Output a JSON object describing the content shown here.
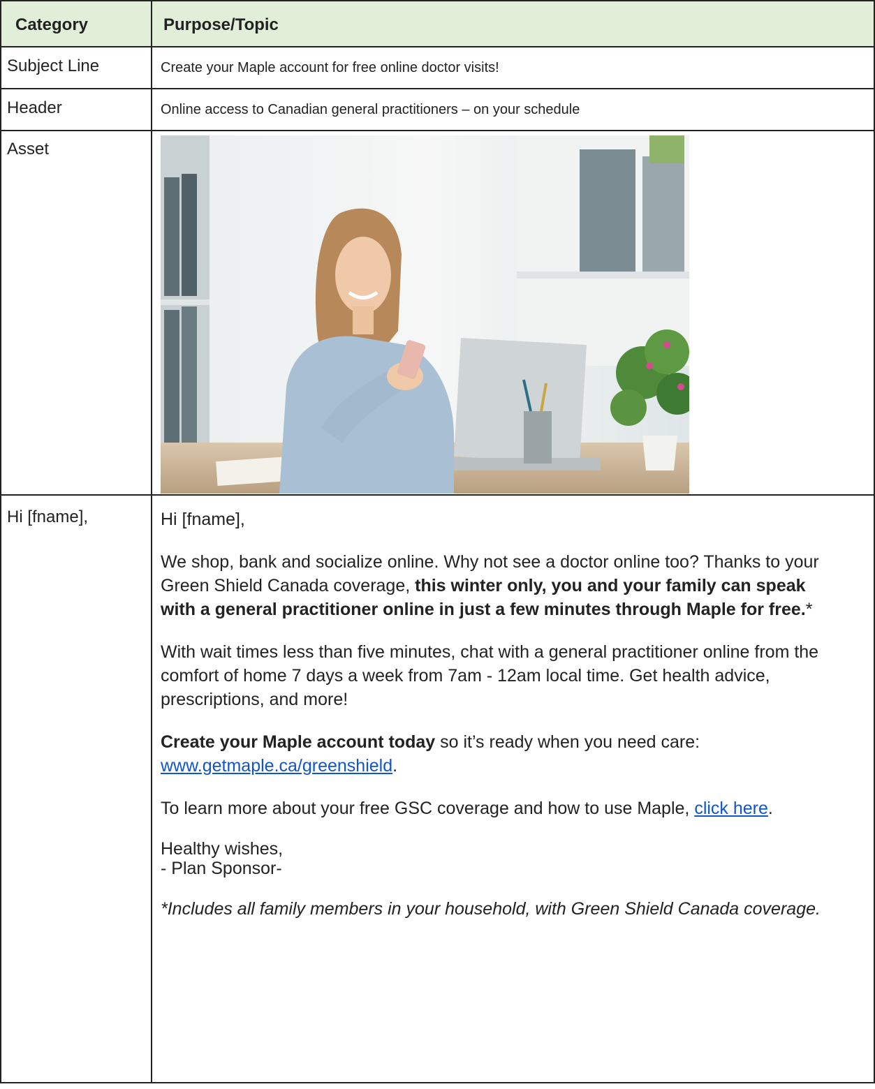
{
  "table": {
    "headers": [
      "Category",
      "Purpose/Topic"
    ],
    "subject": {
      "label": "Subject Line",
      "value": "Create your Maple account for free online doctor visits!"
    },
    "header_row": {
      "label": "Header",
      "value": "Online access to Canadian general practitioners – on your schedule"
    },
    "asset": {
      "label": "Asset",
      "image_description": "Smiling woman at desk using smartphone beside laptop and potted plant"
    },
    "body_row": {
      "label": "Hi [fname],",
      "greeting": "Hi [fname],",
      "p1_normal": "We shop, bank and socialize online. Why not see a doctor online too? Thanks to your Green Shield Canada coverage, ",
      "p1_bold": "this winter only, you and your family can speak with a general practitioner online in just a few minutes through Maple for free.",
      "p1_end": "*",
      "p2": "With wait times less than five minutes, chat with a general practitioner online from the comfort of home 7 days a week from 7am - 12am local time. Get health advice, prescriptions, and more!",
      "p3_bold": "Create your Maple account today",
      "p3_normal": " so it’s ready when you need care: ",
      "p3_link": "www.getmaple.ca/greenshield",
      "p3_end": ".",
      "p4_normal": "To learn more about your free GSC coverage and how to use Maple, ",
      "p4_link": "click here",
      "p4_end": ".",
      "sign1": "Healthy wishes,",
      "sign2": "- Plan Sponsor-",
      "footnote": "*Includes all family members in your household, with Green Shield Canada coverage."
    }
  }
}
